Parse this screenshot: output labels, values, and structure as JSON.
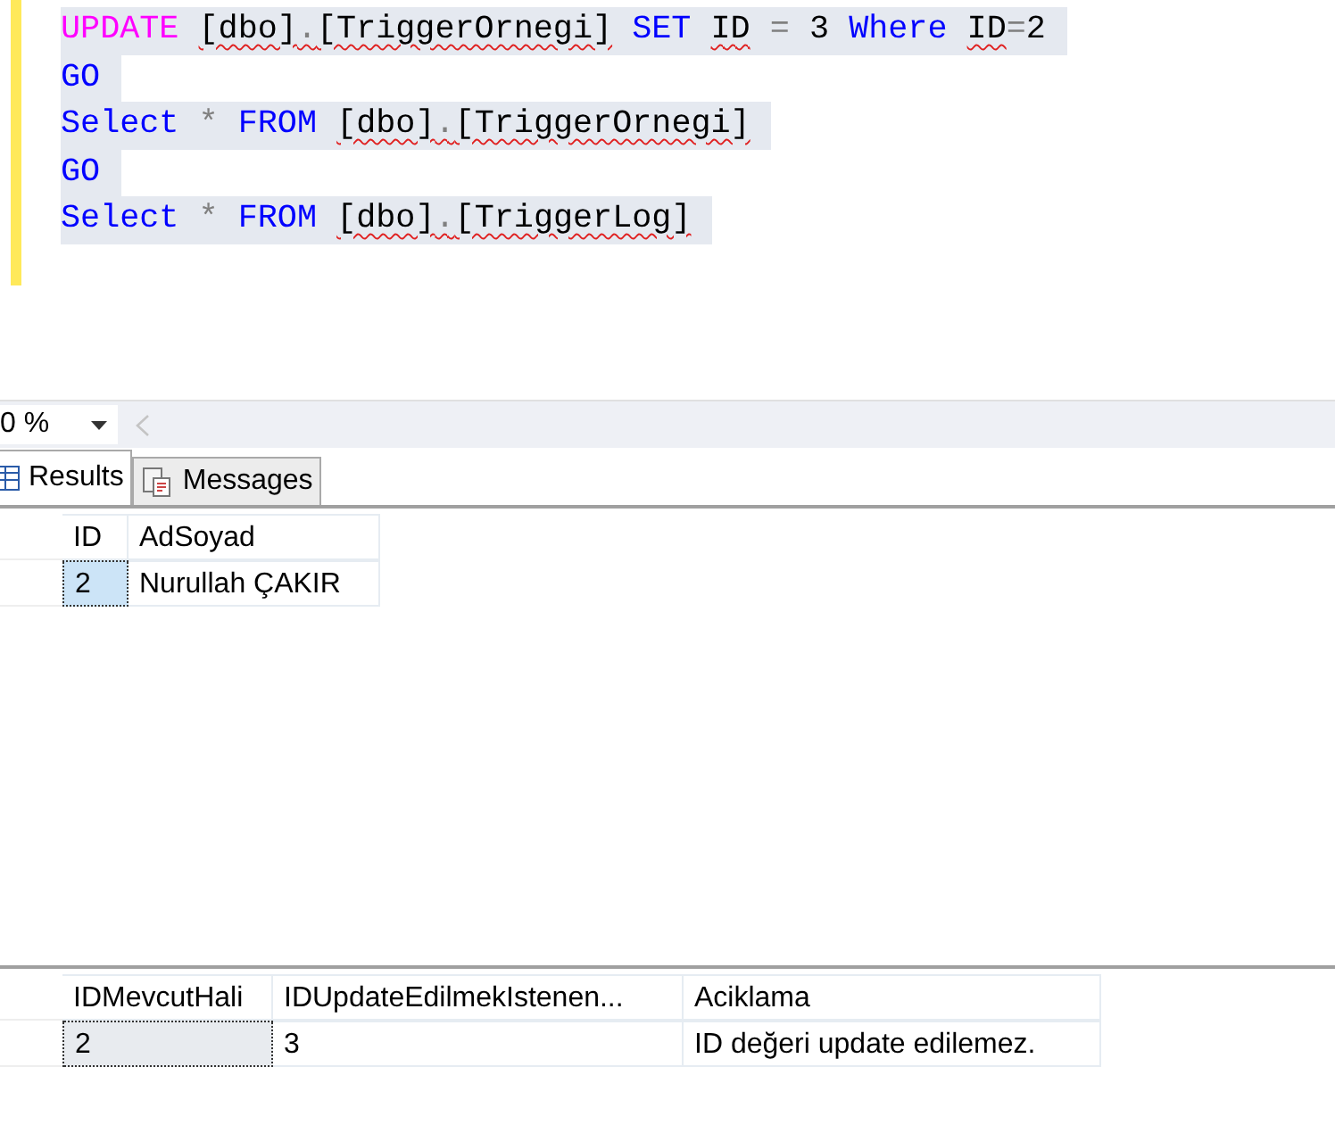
{
  "editor": {
    "lines": [
      {
        "words": [
          [
            {
              "text": "UPDATE",
              "kind": "special",
              "error": false
            }
          ],
          [
            {
              "text": "[dbo]",
              "kind": "plain",
              "error": true
            },
            {
              "text": ".",
              "kind": "operator",
              "error": true
            },
            {
              "text": "[TriggerOrnegi]",
              "kind": "plain",
              "error": true
            }
          ],
          [
            {
              "text": "SET",
              "kind": "keyword",
              "error": false
            }
          ],
          [
            {
              "text": "ID",
              "kind": "plain",
              "error": true
            }
          ],
          [
            {
              "text": "=",
              "kind": "operator",
              "error": false
            }
          ],
          [
            {
              "text": "3",
              "kind": "plain",
              "error": false
            }
          ],
          [
            {
              "text": "Where",
              "kind": "keyword",
              "error": false
            }
          ],
          [
            {
              "text": "ID",
              "kind": "plain",
              "error": true
            },
            {
              "text": "=",
              "kind": "operator",
              "error": false
            },
            {
              "text": "2",
              "kind": "plain",
              "error": false
            }
          ]
        ]
      },
      {
        "words": [
          [
            {
              "text": "GO",
              "kind": "keyword",
              "error": false
            }
          ]
        ]
      },
      {
        "words": [
          [
            {
              "text": "Select",
              "kind": "keyword",
              "error": false
            }
          ],
          [
            {
              "text": "*",
              "kind": "operator",
              "error": false
            }
          ],
          [
            {
              "text": "FROM",
              "kind": "keyword",
              "error": false
            }
          ],
          [
            {
              "text": "[dbo]",
              "kind": "plain",
              "error": true
            },
            {
              "text": ".",
              "kind": "operator",
              "error": true
            },
            {
              "text": "[TriggerOrnegi]",
              "kind": "plain",
              "error": true
            }
          ]
        ]
      },
      {
        "words": [
          [
            {
              "text": "GO",
              "kind": "keyword",
              "error": false
            }
          ]
        ]
      },
      {
        "words": [
          [
            {
              "text": "Select",
              "kind": "keyword",
              "error": false
            }
          ],
          [
            {
              "text": "*",
              "kind": "operator",
              "error": false
            }
          ],
          [
            {
              "text": "FROM",
              "kind": "keyword",
              "error": false
            }
          ],
          [
            {
              "text": "[dbo]",
              "kind": "plain",
              "error": true
            },
            {
              "text": ".",
              "kind": "operator",
              "error": true
            },
            {
              "text": "[TriggerLog]",
              "kind": "plain",
              "error": true
            }
          ]
        ]
      }
    ]
  },
  "zoom": {
    "value": "0 %"
  },
  "tabs": [
    {
      "label": "Results",
      "selected": true
    },
    {
      "label": "Messages",
      "selected": false
    }
  ],
  "grids": [
    {
      "columns": [
        "ID",
        "AdSoyad"
      ],
      "rows": [
        {
          "cells": [
            "2",
            "Nurullah ÇAKIR"
          ]
        }
      ]
    },
    {
      "columns": [
        "IDMevcutHali",
        "IDUpdateEdilmekIstenen...",
        "Aciklama"
      ],
      "rows": [
        {
          "cells": [
            "2",
            "3",
            "ID değeri update edilemez."
          ]
        }
      ]
    }
  ]
}
